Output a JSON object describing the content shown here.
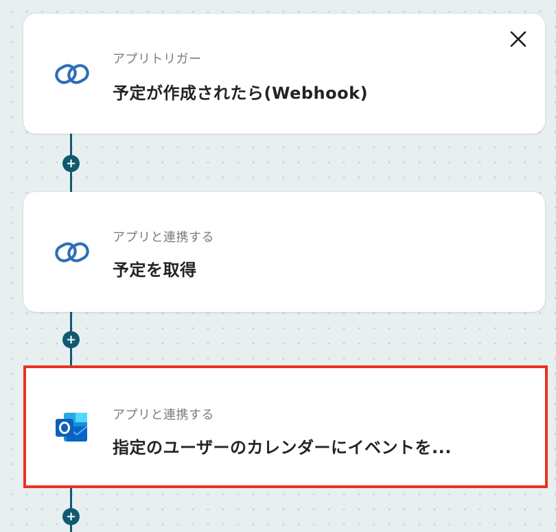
{
  "colors": {
    "connector": "#0f5a70",
    "highlight_border": "#e8321e",
    "chain_icon": "#2f6eb5",
    "outlook_blue": "#0a64c6"
  },
  "flow": {
    "steps": [
      {
        "subtitle": "アプリトリガー",
        "title": "予定が作成されたら(Webhook)",
        "icon": "chain-link-icon"
      },
      {
        "subtitle": "アプリと連携する",
        "title": "予定を取得",
        "icon": "chain-link-icon"
      },
      {
        "subtitle": "アプリと連携する",
        "title": "指定のユーザーのカレンダーにイベントを...",
        "icon": "outlook-icon"
      }
    ],
    "plus_label": "+",
    "close_icon": "close-icon"
  }
}
